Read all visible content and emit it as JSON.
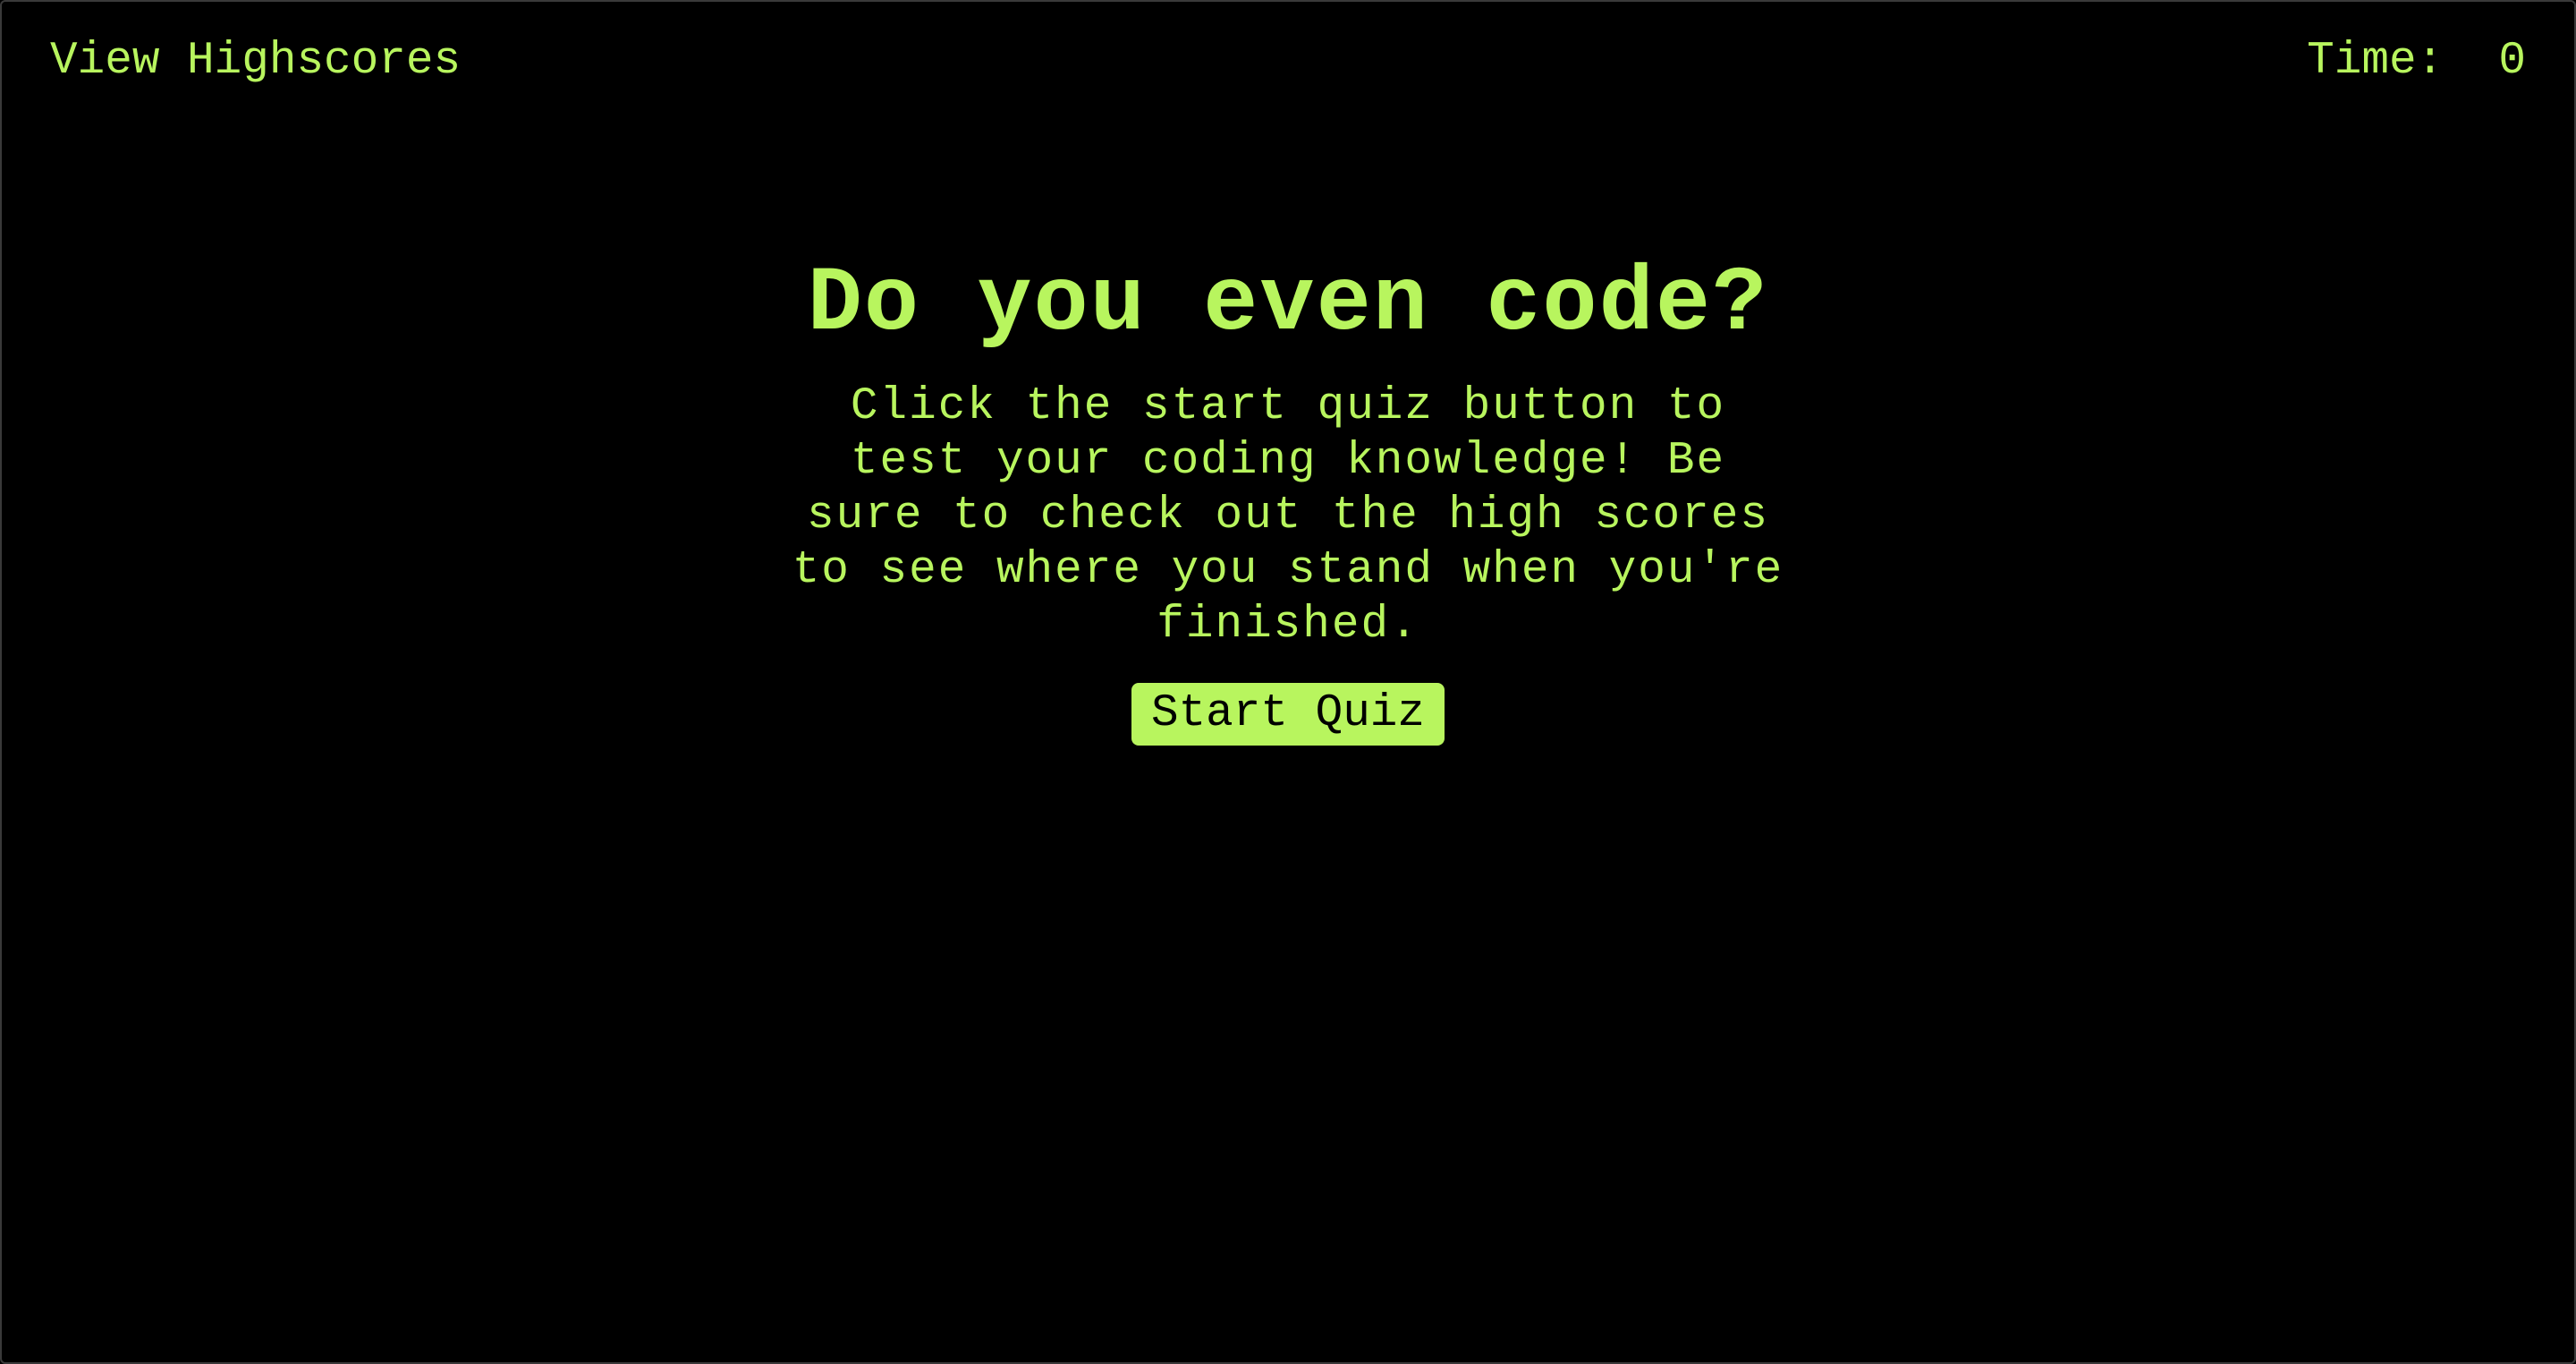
{
  "header": {
    "highscores_label": "View Highscores",
    "timer_label": "Time:",
    "timer_value": "0"
  },
  "main": {
    "title": "Do you even code?",
    "description": "Click the start quiz button to test your coding knowledge! Be sure to check out the high scores to see where you stand when you're finished.",
    "start_button_label": "Start Quiz"
  },
  "colors": {
    "accent": "#b8f55e",
    "background": "#000000"
  }
}
